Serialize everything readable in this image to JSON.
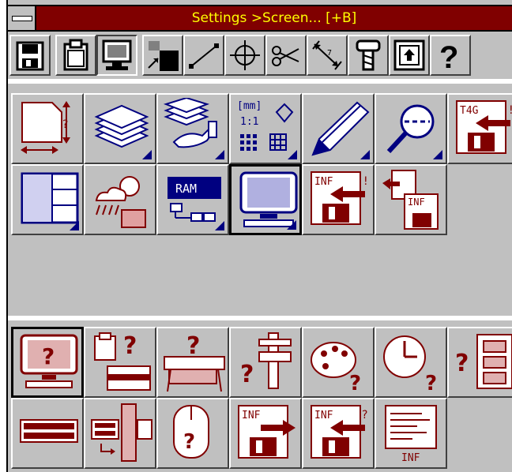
{
  "window": {
    "title": "Settings >Screen... [+B]"
  },
  "toolbar": {
    "buttons": [
      {
        "icon": "save-disk-icon",
        "active": false
      },
      {
        "icon": "clipboard-icon",
        "active": false
      },
      {
        "icon": "monitor-icon",
        "active": true
      },
      {
        "icon": "snap-grid-icon",
        "active": false
      },
      {
        "icon": "line-icon",
        "active": false
      },
      {
        "icon": "crosshair-icon",
        "active": false
      },
      {
        "icon": "scissors-icon",
        "active": false
      },
      {
        "icon": "dimension-icon",
        "active": false
      },
      {
        "icon": "bolt-icon",
        "active": false
      },
      {
        "icon": "frame-upload-icon",
        "active": false
      },
      {
        "icon": "help-question-icon",
        "active": false,
        "text": "?"
      }
    ]
  },
  "settings_grid": {
    "items": [
      {
        "icon": "page-size-icon",
        "labels": [
          "?"
        ]
      },
      {
        "icon": "layers-icon"
      },
      {
        "icon": "layer-hand-icon"
      },
      {
        "icon": "units-scale-icon",
        "labels": [
          "[mm]",
          "1:1"
        ]
      },
      {
        "icon": "pencil-icon"
      },
      {
        "icon": "zoom-magnifier-icon"
      },
      {
        "icon": "t4g-disk-icon",
        "labels": [
          "T4G",
          "!"
        ]
      },
      {
        "icon": "window-layout-icon"
      },
      {
        "icon": "weather-icon"
      },
      {
        "icon": "ram-chip-icon",
        "labels": [
          "RAM"
        ]
      },
      {
        "icon": "screen-settings-icon",
        "selected": true
      },
      {
        "icon": "inf-disk-import-icon",
        "labels": [
          "INF",
          "!"
        ]
      },
      {
        "icon": "inf-door-disk-icon",
        "labels": [
          "INF"
        ]
      }
    ]
  },
  "help_grid": {
    "items": [
      {
        "icon": "monitor-help-icon",
        "labels": [
          "?"
        ],
        "pressed": true
      },
      {
        "icon": "printer-help-icon",
        "labels": [
          "?"
        ]
      },
      {
        "icon": "plotter-help-icon",
        "labels": [
          "?"
        ]
      },
      {
        "icon": "caliper-help-icon",
        "labels": [
          "?"
        ]
      },
      {
        "icon": "palette-help-icon",
        "labels": [
          "?"
        ]
      },
      {
        "icon": "clock-help-icon",
        "labels": [
          "?"
        ]
      },
      {
        "icon": "film-help-icon",
        "labels": [
          "?"
        ]
      },
      {
        "icon": "keyboard-icon"
      },
      {
        "icon": "keyboard-transfer-icon"
      },
      {
        "icon": "mouse-help-icon",
        "labels": [
          "?"
        ]
      },
      {
        "icon": "inf-disk-export-icon",
        "labels": [
          "INF"
        ]
      },
      {
        "icon": "inf-disk-help-icon",
        "labels": [
          "INF",
          "?"
        ]
      },
      {
        "icon": "inf-document-icon",
        "labels": [
          "INF"
        ]
      }
    ]
  },
  "colors": {
    "title_bg": "#800000",
    "title_text": "#ffff00",
    "icon_red": "#800000",
    "icon_blue": "#000080",
    "face": "#c0c0c0"
  }
}
